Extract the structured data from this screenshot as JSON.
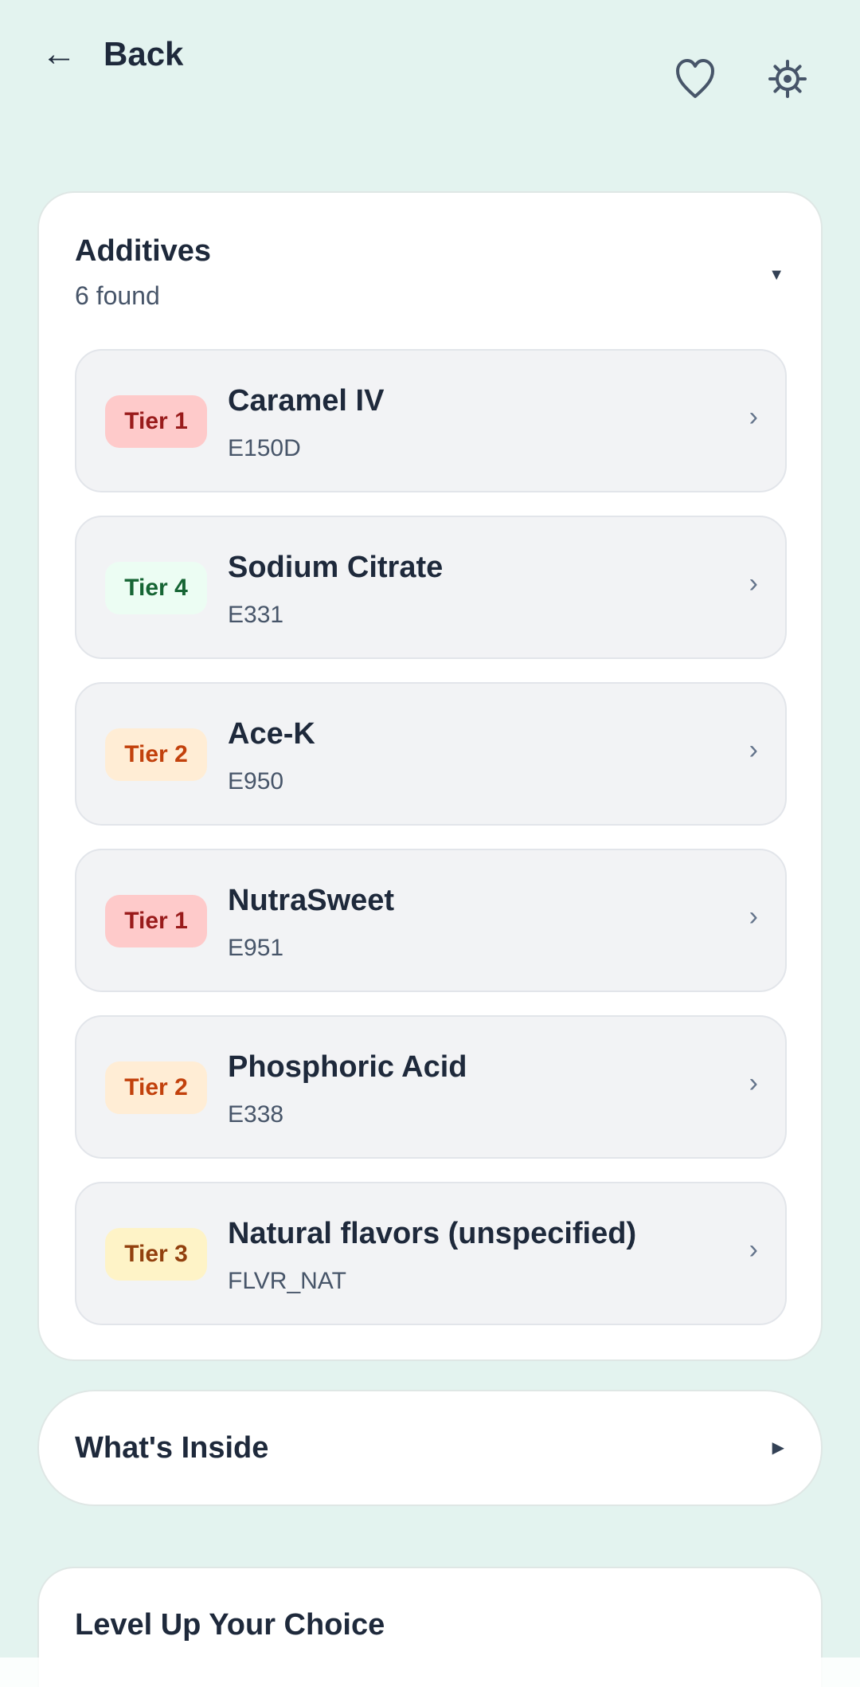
{
  "header": {
    "back_arrow": "←",
    "back_label": "Back",
    "favorite_icon": "heart-outline-icon",
    "settings_icon": "gear-icon"
  },
  "additives": {
    "title": "Additives",
    "count_text": "6 found",
    "expand_indicator": "▼",
    "items": [
      {
        "tier": "Tier 1",
        "name": "Caramel IV",
        "code": "E150D",
        "chevron": "›",
        "badge_bg": "#fecaca",
        "badge_fg": "#991b1b"
      },
      {
        "tier": "Tier 4",
        "name": "Sodium Citrate",
        "code": "E331",
        "chevron": "›",
        "badge_bg": "#ecfdf3",
        "badge_fg": "#166534"
      },
      {
        "tier": "Tier 2",
        "name": "Ace-K",
        "code": "E950",
        "chevron": "›",
        "badge_bg": "#ffedd5",
        "badge_fg": "#c2410c"
      },
      {
        "tier": "Tier 1",
        "name": "NutraSweet",
        "code": "E951",
        "chevron": "›",
        "badge_bg": "#fecaca",
        "badge_fg": "#991b1b"
      },
      {
        "tier": "Tier 2",
        "name": "Phosphoric Acid",
        "code": "E338",
        "chevron": "›",
        "badge_bg": "#ffedd5",
        "badge_fg": "#c2410c"
      },
      {
        "tier": "Tier 3",
        "name": "Natural flavors (unspecified)",
        "code": "FLVR_NAT",
        "chevron": "›",
        "badge_bg": "#fef3c7",
        "badge_fg": "#92400e"
      }
    ]
  },
  "whats_inside": {
    "title": "What's Inside",
    "expand_indicator": "▶"
  },
  "level_up": {
    "title": "Level Up Your Choice"
  },
  "colors": {
    "background": "#e3f3ef",
    "card": "#ffffff",
    "item": "#f2f3f5",
    "text_primary": "#1e293b",
    "text_secondary": "#475569"
  }
}
